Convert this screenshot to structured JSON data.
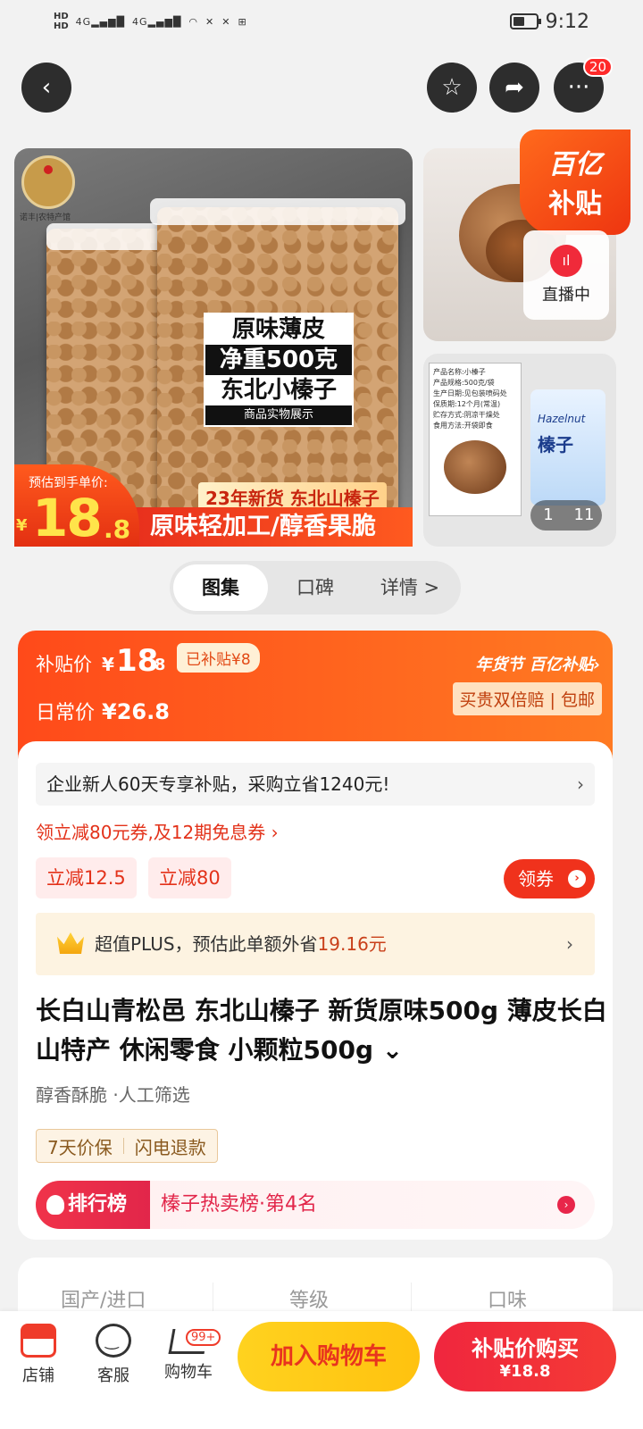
{
  "status_bar": {
    "left_indicators": "HD 4G 4G",
    "time": "9:12"
  },
  "header": {
    "more_badge": "20"
  },
  "gallery": {
    "logo_text": "诺丰|农特产馆",
    "label_lines": [
      "原味薄皮",
      "净重500克",
      "东北小榛子"
    ],
    "label_sub": "商品实物展示",
    "promo_tag": "23年新货 东北山榛子",
    "promo_strip": "原味轻加工/醇香果脆",
    "est_label": "预估到手单价:",
    "est_price_int": "18",
    "est_price_dec": ".8",
    "subsidy_line1": "百亿",
    "subsidy_line2": "补贴",
    "live_label": "直播中",
    "spec_lines": [
      "产品名称:小榛子",
      "产品规格:500克/袋",
      "生产日期:见包装喷码处",
      "保质期:12个月(常温)",
      "贮存方式:阴凉干燥处",
      "食用方法:开袋即食"
    ],
    "pack_small": "Hazelnut",
    "pack_big": "榛子",
    "counter_current": "1",
    "counter_total": "11"
  },
  "segment": {
    "tabs": [
      "图集",
      "口碑",
      "详情 >"
    ]
  },
  "price_card": {
    "subsidy_label": "补贴价",
    "yen": "¥",
    "subsidy_price_int": "18",
    "subsidy_price_dec": ".8",
    "saved": "已补贴¥8",
    "daily_label": "日常价",
    "daily_price": "¥26.8",
    "brand_tag": "年货节 百亿补贴›",
    "guarantee": "买贵双倍赔 | 包邮"
  },
  "offers": {
    "new_customer": "企业新人60天专享补贴，采购立省1240元!",
    "coupon_link": "领立减80元券,及12期免息券 ›",
    "chips": [
      "立减12.5",
      "立减80"
    ],
    "get_coupon": "领券",
    "plus_text": "超值PLUS，预估此单额外省",
    "plus_amount": "19.16元"
  },
  "product": {
    "title": "长白山青松邑 东北山榛子 新货原味500g 薄皮长白山特产 休闲零食 小颗粒500g ⌄",
    "features": "醇香酥脆  ·人工筛选",
    "tags": [
      "7天价保",
      "闪电退款"
    ],
    "rank_label": "排行榜",
    "rank_text": "榛子热卖榜·第4名"
  },
  "attributes": [
    "国产/进口",
    "等级",
    "口味"
  ],
  "bottom_bar": {
    "shop": "店铺",
    "service": "客服",
    "cart": "购物车",
    "cart_badge": "99+",
    "add_to_cart": "加入购物车",
    "buy_line1": "补贴价购买",
    "buy_line2": "¥18.8"
  },
  "colors": {
    "accent": "#ff4a1a",
    "buy": "#f0263e",
    "cart": "#ffd21f"
  }
}
